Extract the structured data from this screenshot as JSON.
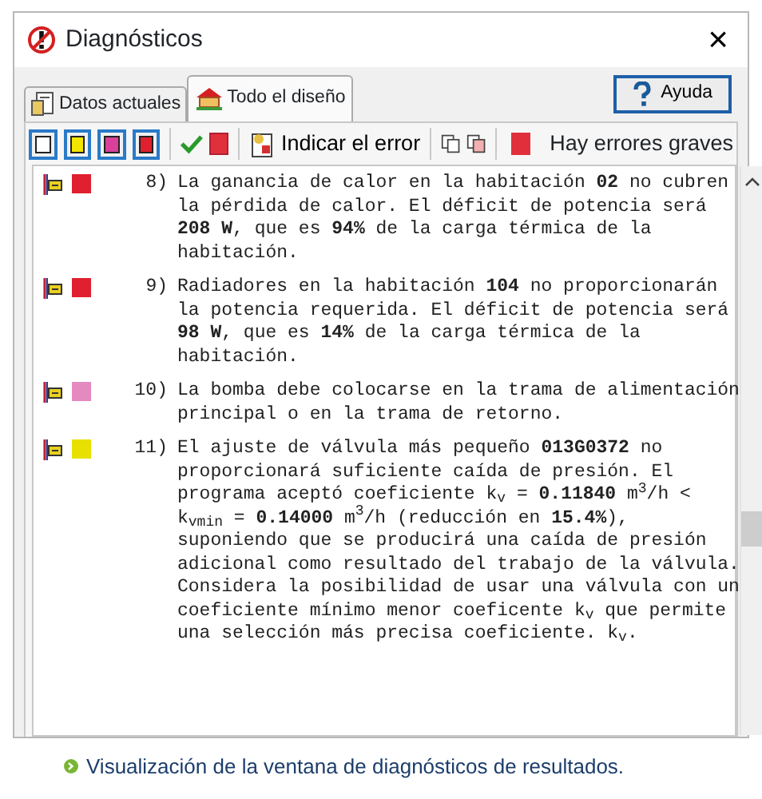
{
  "window": {
    "title": "Diagnósticos",
    "close": "×"
  },
  "tabs": [
    {
      "label": "Datos actuales",
      "selected": false
    },
    {
      "label": "Todo el diseño",
      "selected": true
    }
  ],
  "help_button": {
    "label": "Ayuda"
  },
  "toolbar": {
    "filters": [
      {
        "color": "#ffffff",
        "selected": true
      },
      {
        "color": "#f2e600",
        "selected": true
      },
      {
        "color": "#d9409a",
        "selected": true
      },
      {
        "color": "#e0202e",
        "selected": true
      }
    ],
    "indicate_button": {
      "label": "Indicar el error"
    },
    "status": {
      "label": "Hay errores graves",
      "color": "#e0303c"
    }
  },
  "messages": [
    {
      "number": "8)",
      "color": "#e0202e",
      "text": "La ganancia de calor en la habitación **02** no cubren la pérdida de calor. El déficit de potencia será **208 W**, que es **94%** de la carga térmica de la habitación."
    },
    {
      "number": "9)",
      "color": "#e0202e",
      "text": "Radiadores en la habitación **104** no proporcionarán la potencia requerida. El déficit de potencia será **98 W**, que es **14%** de la carga térmica de la habitación."
    },
    {
      "number": "10)",
      "color": "#e48ac0",
      "text": "La bomba debe colocarse en la trama de alimentación principal o en la trama de retorno."
    },
    {
      "number": "11)",
      "color": "#e8e000",
      "text": "El ajuste de válvula más pequeño **013G0372** no proporcionará suficiente caída de presión. El programa aceptó coeficiente k$_{v}$ = **0.11840** m$^{3}$/h < k$_{vmin}$ = **0.14000** m$^{3}$/h (reducción en **15.4%**), suponiendo que se producirá una caída de presión adicional como resultado del trabajo de la válvula. Considera la posibilidad de usar una válvula con un coeficiente mínimo menor coeficente k$_{v}$ que permite una selección más precisa coeficiente. k$_{v}$."
    }
  ],
  "caption": "Visualización de la ventana de diagnósticos de resultados."
}
